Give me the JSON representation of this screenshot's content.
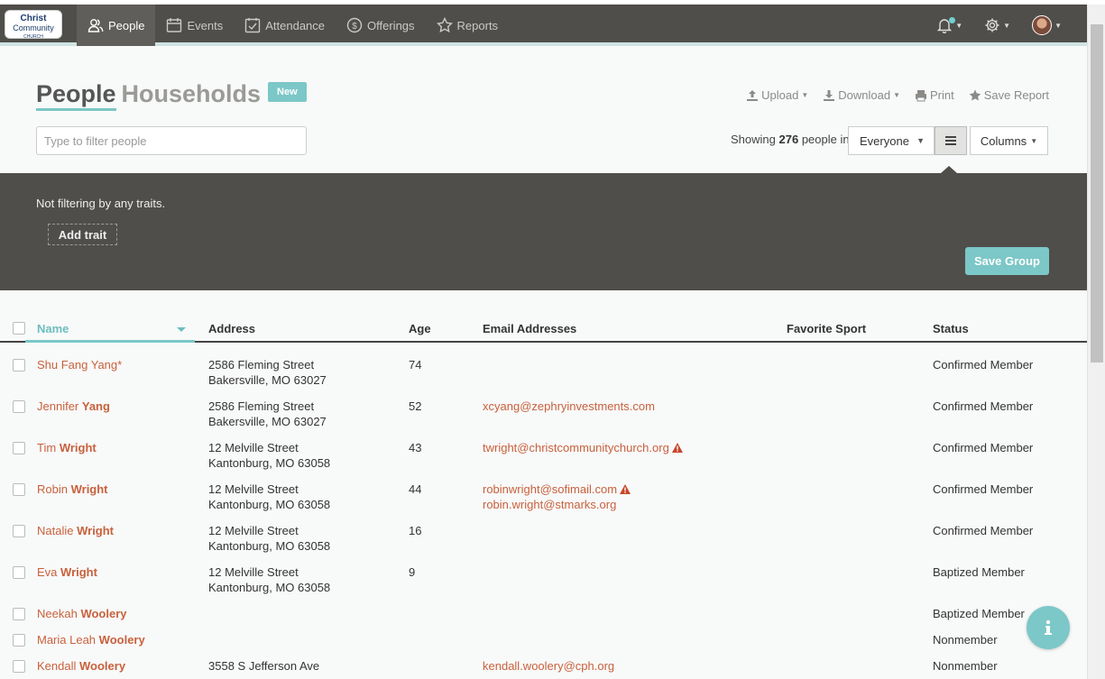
{
  "brand": {
    "line1": "Christ",
    "line2": "Community",
    "line3": "CHURCH"
  },
  "nav": [
    {
      "label": "People",
      "icon": "people-icon",
      "active": true
    },
    {
      "label": "Events",
      "icon": "calendar-icon"
    },
    {
      "label": "Attendance",
      "icon": "checkbox-calendar-icon"
    },
    {
      "label": "Offerings",
      "icon": "money-icon"
    },
    {
      "label": "Reports",
      "icon": "star-icon"
    }
  ],
  "header": {
    "title_people": "People",
    "title_households": "Households",
    "new_label": "New"
  },
  "actions": {
    "upload": "Upload",
    "download": "Download",
    "print": "Print",
    "save_report": "Save Report"
  },
  "filter": {
    "placeholder": "Type to filter people"
  },
  "showing": {
    "prefix": "Showing",
    "count": "276",
    "suffix": "people in"
  },
  "scope_select": {
    "value": "Everyone"
  },
  "columns_label": "Columns",
  "traits": {
    "status_text": "Not filtering by any traits.",
    "add_trait": "Add trait",
    "save_group": "Save Group"
  },
  "table": {
    "headers": {
      "name": "Name",
      "address": "Address",
      "age": "Age",
      "email": "Email Addresses",
      "sport": "Favorite Sport",
      "status": "Status"
    },
    "rows": [
      {
        "first": "Shu Fang Yang*",
        "last": "",
        "addr1": "2586 Fleming Street",
        "addr2": "Bakersville, MO  63027",
        "age": "74",
        "email1": "",
        "email1_warn": false,
        "email2": "",
        "status": "Confirmed Member"
      },
      {
        "first": "Jennifer",
        "last": "Yang",
        "addr1": "2586 Fleming Street",
        "addr2": "Bakersville, MO  63027",
        "age": "52",
        "email1": "xcyang@zephryinvestments.com",
        "email1_warn": false,
        "email2": "",
        "status": "Confirmed Member"
      },
      {
        "first": "Tim",
        "last": "Wright",
        "addr1": "12 Melville Street",
        "addr2": "Kantonburg, MO  63058",
        "age": "43",
        "email1": "twright@christcommunitychurch.org",
        "email1_warn": true,
        "email2": "",
        "status": "Confirmed Member"
      },
      {
        "first": "Robin",
        "last": "Wright",
        "addr1": "12 Melville Street",
        "addr2": "Kantonburg, MO  63058",
        "age": "44",
        "email1": "robinwright@sofimail.com",
        "email1_warn": true,
        "email2": "robin.wright@stmarks.org",
        "status": "Confirmed Member"
      },
      {
        "first": "Natalie",
        "last": "Wright",
        "addr1": "12 Melville Street",
        "addr2": "Kantonburg, MO  63058",
        "age": "16",
        "email1": "",
        "email1_warn": false,
        "email2": "",
        "status": "Confirmed Member"
      },
      {
        "first": "Eva",
        "last": "Wright",
        "addr1": "12 Melville Street",
        "addr2": "Kantonburg, MO  63058",
        "age": "9",
        "email1": "",
        "email1_warn": false,
        "email2": "",
        "status": "Baptized Member"
      },
      {
        "first": "Neekah",
        "last": "Woolery",
        "addr1": "",
        "addr2": "",
        "age": "",
        "email1": "",
        "email1_warn": false,
        "email2": "",
        "status": "Baptized Member"
      },
      {
        "first": "Maria Leah",
        "last": "Woolery",
        "addr1": "",
        "addr2": "",
        "age": "",
        "email1": "",
        "email1_warn": false,
        "email2": "",
        "status": "Nonmember"
      },
      {
        "first": "Kendall",
        "last": "Woolery",
        "addr1": "3558 S Jefferson Ave",
        "addr2": "",
        "age": "",
        "email1": "kendall.woolery@cph.org",
        "email1_warn": false,
        "email2": "",
        "status": "Nonmember"
      }
    ]
  },
  "colors": {
    "accent": "#7cc7c7",
    "topbar": "#4f4e4a",
    "link": "#c8613c",
    "warning": "#c8452c"
  }
}
